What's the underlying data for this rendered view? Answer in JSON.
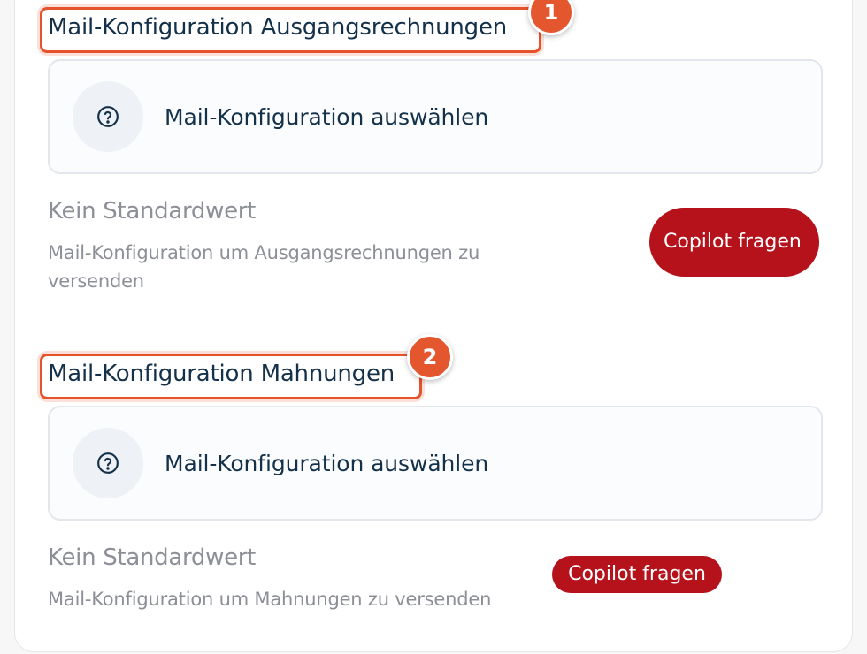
{
  "sections": [
    {
      "title": "Mail-Konfiguration Ausgangsrechnungen",
      "marker": "1",
      "select_label": "Mail-Konfiguration auswählen",
      "default_value": "Kein Standardwert",
      "description": "Mail-Konfiguration um Ausgangsrechnungen zu versenden",
      "copilot_label": "Copilot fragen"
    },
    {
      "title": "Mail-Konfiguration Mahnungen",
      "marker": "2",
      "select_label": "Mail-Konfiguration auswählen",
      "default_value": "Kein Standardwert",
      "description": "Mail-Konfiguration um Mahnungen zu versenden",
      "copilot_label": "Copilot fragen"
    }
  ],
  "icons": {
    "selector_icon": "question-circle-icon"
  },
  "colors": {
    "title": "#14314a",
    "muted_text": "#8c9096",
    "copilot_button": "#b5121b",
    "highlight": "#e5532b"
  }
}
